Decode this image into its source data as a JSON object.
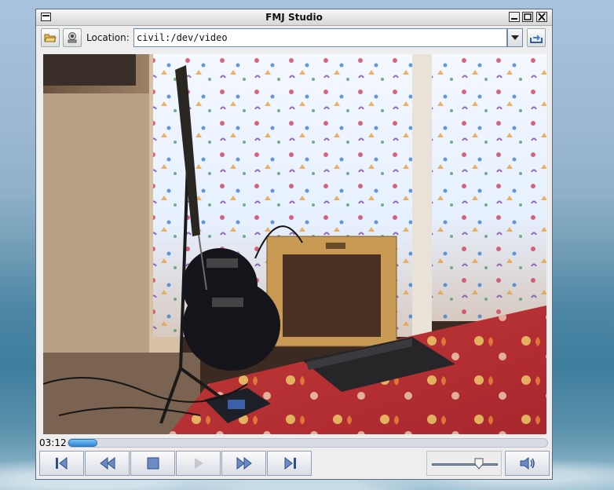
{
  "window": {
    "title": "FMJ Studio",
    "minimize_label": "_",
    "maximize_label": "□",
    "close_label": "✕"
  },
  "toolbar": {
    "open_file_icon": "folder-open-icon",
    "capture_icon": "webcam-icon",
    "location_label": "Location:",
    "location_value": "civil:/dev/video",
    "go_icon": "load-arrow-icon"
  },
  "video": {
    "description_icon": "video-frame"
  },
  "seek": {
    "time": "03:12",
    "progress": 0.06
  },
  "controls": {
    "buttons": [
      {
        "name": "step-back-button",
        "icon": "step-back-icon",
        "enabled": true
      },
      {
        "name": "rewind-button",
        "icon": "rewind-icon",
        "enabled": true
      },
      {
        "name": "stop-button",
        "icon": "stop-icon",
        "enabled": true
      },
      {
        "name": "play-button",
        "icon": "play-icon",
        "enabled": false
      },
      {
        "name": "fast-forward-button",
        "icon": "fast-forward-icon",
        "enabled": true
      },
      {
        "name": "step-forward-button",
        "icon": "step-forward-icon",
        "enabled": true
      }
    ],
    "volume_level": 0.72,
    "speaker_icon": "speaker-icon"
  },
  "colors": {
    "accent": "#3a8fd9",
    "icon_blue": "#2e4f8a"
  }
}
